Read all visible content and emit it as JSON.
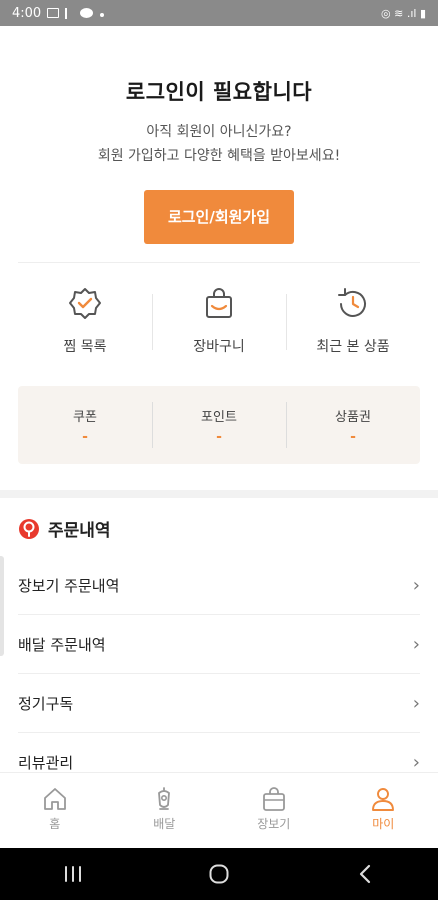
{
  "status_bar": {
    "time": "4:00",
    "right_text": "◎ ≋ .ıl ▮"
  },
  "hero": {
    "title": "로그인이 필요합니다",
    "sub_line1": "아직 회원이 아니신가요?",
    "sub_line2": "회원 가입하고 다양한 혜택을 받아보세요!",
    "login_button": "로그인/회원가입"
  },
  "quick_links": [
    {
      "label": "찜 목록",
      "icon": "badge-check-icon"
    },
    {
      "label": "장바구니",
      "icon": "shopping-bag-icon"
    },
    {
      "label": "최근 본 상품",
      "icon": "history-clock-icon"
    }
  ],
  "points": [
    {
      "label": "쿠폰",
      "value": "-"
    },
    {
      "label": "포인트",
      "value": "-"
    },
    {
      "label": "상품권",
      "value": "-"
    }
  ],
  "orders": {
    "title": "주문내역",
    "items": [
      {
        "label": "장보기 주문내역"
      },
      {
        "label": "배달 주문내역"
      },
      {
        "label": "정기구독"
      },
      {
        "label": "리뷰관리"
      }
    ],
    "chevron": "›"
  },
  "tabs": [
    {
      "label": "홈",
      "icon": "home-icon",
      "active": false
    },
    {
      "label": "배달",
      "icon": "delivery-icon",
      "active": false
    },
    {
      "label": "장보기",
      "icon": "shopping-icon",
      "active": false
    },
    {
      "label": "마이",
      "icon": "user-icon",
      "active": true
    }
  ],
  "colors": {
    "accent": "#f08a3c",
    "points_bg": "#f7f3ef",
    "orders_icon": "#e8392d"
  },
  "nav": {
    "recents": "|||",
    "home": "○",
    "back": "‹"
  }
}
